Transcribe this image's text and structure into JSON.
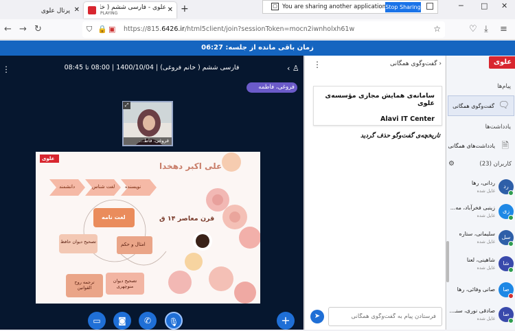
{
  "browser": {
    "tabs": [
      {
        "title": "پرتال علوی"
      },
      {
        "title": "علوی - فارسی ششم ( خانم فروغ",
        "subtitle": "PLAYING"
      }
    ],
    "sharing_notice": "You are sharing another application window.",
    "stop_sharing_label": "Stop Sharing",
    "url_prefix": "https://815.",
    "url_domain": "6426.ir",
    "url_rest": "/html5client/join?sessionToken=mocn2iwnholxh61w"
  },
  "timer": {
    "label": "زمان باقی مانده از جلسه: 06:27"
  },
  "meeting": {
    "title": "فارسی ششم ( خانم فروغی) | 1400/10/04 | 08:00 تا 08:45",
    "presenter": "فروغی، فاطمه",
    "camera_name": "فروغی، فاط..."
  },
  "slide": {
    "logo": "علوی",
    "heading": "علی اکبر دهخدا",
    "subheading": "قرن معاصر  ۱۴ ق",
    "tags": [
      "نویسنده",
      "لغت شناس",
      "دانشمند"
    ],
    "center": "لغت نامه",
    "works": [
      "امثال و حکم",
      "تصحیح دیوان حافظ",
      "ترجمه روح القوانین",
      "تصحیح دیوان منوچهری"
    ]
  },
  "chat": {
    "header": "گفت‌وگوی همگانی",
    "welcome_line1": "سامانه‌ی همایش مجازی مؤسسه‌ی علوی",
    "welcome_line2": "Alavi IT Center",
    "cleared_notice": "تاریخچه‌ی گفت‌وگو حذف گردید",
    "input_placeholder": "فرستادن پیام به گفت‌وگوی همگانی"
  },
  "sidebar": {
    "logo": "علوی",
    "messages_header": "پیام‌ها",
    "shared_chat": "گفت‌وگوی همگانی",
    "notes_header": "یادداشت‌ها",
    "shared_notes": "یادداشت‌های همگانی",
    "users_header": "کاربران (23)",
    "users": [
      {
        "initials": "رد",
        "name": "ردانی، رها",
        "status": "غایل شده",
        "color": "#2e5fa8"
      },
      {
        "initials": "زی",
        "name": "زینبی فخرآباد، مه...",
        "status": "غایل شده",
        "color": "#1e88e5"
      },
      {
        "initials": "سل",
        "name": "سلیمانی، ستاره",
        "status": "غایل شده",
        "color": "#2e5fa8"
      },
      {
        "initials": "شا",
        "name": "شاهینی، لعنا",
        "status": "غایل شده",
        "color": "#3949ab"
      },
      {
        "initials": "صا",
        "name": "صانی وفائی، رها",
        "status": "",
        "color": "#1e88e5"
      },
      {
        "initials": "صا",
        "name": "صادقی نوری، سنـ...",
        "status": "غایل شده",
        "color": "#3949ab"
      }
    ]
  },
  "colors": {
    "accent": "#1565c0",
    "brand": "#d8262f",
    "video_bg": "#06172f"
  }
}
